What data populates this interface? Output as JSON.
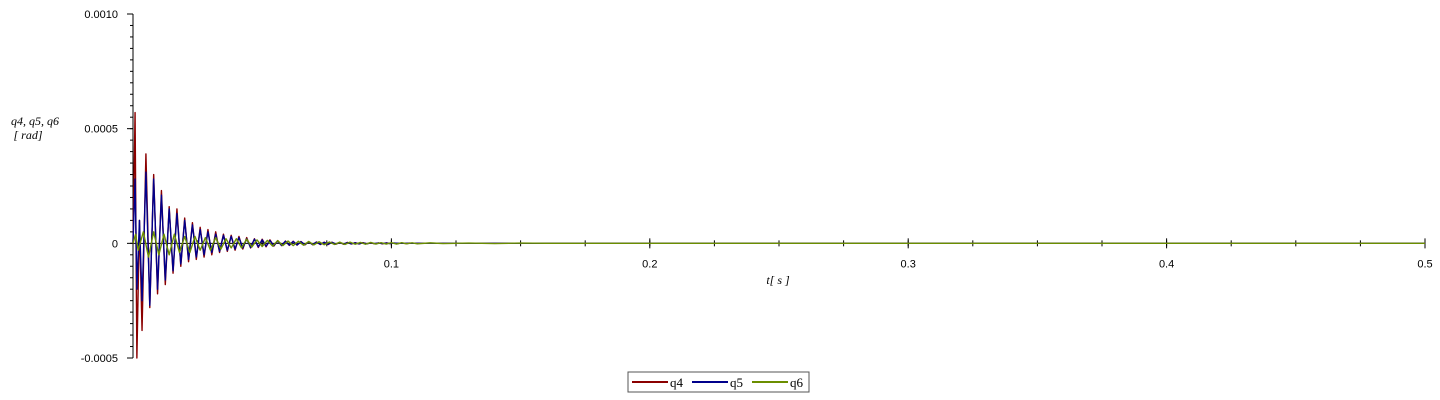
{
  "chart_data": {
    "type": "line",
    "title": "",
    "xlabel": "t[ s ]",
    "ylabel_lines": [
      "q4, q5, q6",
      "[ rad]"
    ],
    "xlim": [
      0,
      0.5
    ],
    "ylim": [
      -0.0005,
      0.001
    ],
    "x_ticks": [
      0.1,
      0.2,
      0.3,
      0.4,
      0.5
    ],
    "x_tick_labels": [
      "0.1",
      "0.2",
      "0.3",
      "0.4",
      "0.5"
    ],
    "y_ticks": [
      0.001,
      0.0005,
      0,
      -0.0005
    ],
    "y_tick_labels": [
      "0.0010",
      "0.0005",
      "0",
      "-0.0005"
    ],
    "grid": false,
    "legend_position": "bottom-center",
    "series": [
      {
        "name": "q4",
        "color": "#8b0000",
        "x": [
          0,
          0.0008,
          0.0015,
          0.0025,
          0.0035,
          0.005,
          0.0065,
          0.008,
          0.0095,
          0.011,
          0.0125,
          0.014,
          0.0155,
          0.017,
          0.0185,
          0.02,
          0.0215,
          0.023,
          0.0245,
          0.026,
          0.0275,
          0.029,
          0.0305,
          0.032,
          0.0335,
          0.035,
          0.0365,
          0.038,
          0.0395,
          0.041,
          0.0425,
          0.044,
          0.0455,
          0.047,
          0.0485,
          0.05,
          0.0515,
          0.053,
          0.0545,
          0.056,
          0.0575,
          0.059,
          0.0605,
          0.062,
          0.0635,
          0.065,
          0.0665,
          0.068,
          0.0695,
          0.071,
          0.0725,
          0.074,
          0.0755,
          0.077,
          0.0785,
          0.08,
          0.0815,
          0.083,
          0.0845,
          0.086,
          0.0875,
          0.089,
          0.0905,
          0.092,
          0.0935,
          0.095,
          0.0965,
          0.098,
          0.0995,
          0.101,
          0.1025,
          0.104,
          0.1055,
          0.107,
          0.1085,
          0.11,
          0.12,
          0.14,
          0.16,
          0.18,
          0.2,
          0.3,
          0.4,
          0.5
        ],
        "y": [
          0,
          0.00057,
          -0.0005,
          0.0001,
          -0.00038,
          0.00039,
          -0.00028,
          0.0003,
          -0.00022,
          0.00023,
          -0.00018,
          0.00016,
          -0.00013,
          0.00015,
          -0.0001,
          0.00011,
          -8e-05,
          9e-05,
          -7e-05,
          7e-05,
          -6e-05,
          6e-05,
          -5e-05,
          5e-05,
          -4e-05,
          4e-05,
          -3.5e-05,
          3.5e-05,
          -3e-05,
          3e-05,
          -2.5e-05,
          2.5e-05,
          -2e-05,
          2e-05,
          -1.8e-05,
          1.8e-05,
          -1.5e-05,
          1.5e-05,
          -1.2e-05,
          1.2e-05,
          -1e-05,
          1e-05,
          -9e-06,
          9e-06,
          -8e-06,
          8e-06,
          -7e-06,
          7e-06,
          -6e-06,
          6e-06,
          -5e-06,
          5e-06,
          -5e-06,
          5e-06,
          -4e-06,
          4e-06,
          -4e-06,
          4e-06,
          -3e-06,
          3e-06,
          -3e-06,
          3e-06,
          -2e-06,
          2e-06,
          -2e-06,
          2e-06,
          -2e-06,
          2e-06,
          -1e-06,
          1e-06,
          -1e-06,
          1e-06,
          -1e-06,
          1e-06,
          0,
          0,
          0,
          0,
          0,
          0,
          0,
          0,
          0,
          0
        ]
      },
      {
        "name": "q5",
        "color": "#00008b",
        "x": [
          0,
          0.0008,
          0.0015,
          0.0025,
          0.0035,
          0.005,
          0.0065,
          0.008,
          0.0095,
          0.011,
          0.0125,
          0.014,
          0.0155,
          0.017,
          0.0185,
          0.02,
          0.0215,
          0.023,
          0.0245,
          0.026,
          0.0275,
          0.029,
          0.0305,
          0.032,
          0.0335,
          0.035,
          0.0365,
          0.038,
          0.0395,
          0.041,
          0.0425,
          0.044,
          0.0455,
          0.047,
          0.0485,
          0.05,
          0.0515,
          0.053,
          0.0545,
          0.056,
          0.0575,
          0.059,
          0.0605,
          0.062,
          0.0635,
          0.065,
          0.0665,
          0.068,
          0.0695,
          0.071,
          0.0725,
          0.074,
          0.0755,
          0.077,
          0.0785,
          0.08,
          0.0815,
          0.083,
          0.0845,
          0.086,
          0.0875,
          0.089,
          0.0905,
          0.092,
          0.0935,
          0.095,
          0.0965,
          0.098,
          0.0995,
          0.101,
          0.1025,
          0.104,
          0.1055,
          0.107,
          0.1085,
          0.11,
          0.12,
          0.14,
          0.16,
          0.18,
          0.19,
          0.2,
          0.3,
          0.4,
          0.5
        ],
        "y": [
          0,
          0.00028,
          -0.0002,
          0.0001,
          -0.00025,
          0.00031,
          -0.00027,
          0.00028,
          -0.0002,
          0.00021,
          -0.00016,
          0.00015,
          -0.00012,
          0.00013,
          -9e-05,
          0.0001,
          -7e-05,
          8e-05,
          -6e-05,
          6e-05,
          -5e-05,
          5e-05,
          -4e-05,
          4e-05,
          -3.5e-05,
          3.5e-05,
          -3e-05,
          3e-05,
          -2.5e-05,
          2.5e-05,
          -2e-05,
          2e-05,
          -1.8e-05,
          1.8e-05,
          -1.5e-05,
          1.5e-05,
          -1.2e-05,
          1.2e-05,
          -1e-05,
          1e-05,
          -9e-06,
          9e-06,
          -8e-06,
          8e-06,
          -7e-06,
          7e-06,
          -6e-06,
          6e-06,
          -5e-06,
          5e-06,
          -4e-06,
          4e-06,
          -4e-06,
          4e-06,
          -3e-06,
          3e-06,
          -3e-06,
          3e-06,
          -2e-06,
          2e-06,
          -2e-06,
          2e-06,
          -2e-06,
          2e-06,
          -1e-06,
          1e-06,
          -1e-06,
          1e-06,
          -1e-06,
          1e-06,
          0,
          0,
          0,
          0,
          0,
          0,
          0,
          0,
          0,
          0,
          0,
          0,
          0,
          0,
          0
        ]
      },
      {
        "name": "q6",
        "color": "#6b8e00",
        "x": [
          0,
          0.001,
          0.002,
          0.004,
          0.006,
          0.008,
          0.01,
          0.012,
          0.014,
          0.016,
          0.018,
          0.02,
          0.022,
          0.024,
          0.026,
          0.028,
          0.03,
          0.032,
          0.034,
          0.036,
          0.038,
          0.04,
          0.042,
          0.044,
          0.046,
          0.048,
          0.05,
          0.052,
          0.054,
          0.056,
          0.058,
          0.06,
          0.062,
          0.064,
          0.066,
          0.068,
          0.07,
          0.072,
          0.074,
          0.076,
          0.078,
          0.08,
          0.082,
          0.084,
          0.086,
          0.088,
          0.09,
          0.092,
          0.094,
          0.096,
          0.098,
          0.1,
          0.102,
          0.104,
          0.106,
          0.108,
          0.11,
          0.115,
          0.12,
          0.13,
          0.14,
          0.15,
          0.16,
          0.18,
          0.2,
          0.3,
          0.4,
          0.5
        ],
        "y": [
          0,
          4e-05,
          -3e-05,
          5e-05,
          -6e-05,
          5e-05,
          -5e-05,
          4e-05,
          -5e-05,
          4e-05,
          -4e-05,
          3e-05,
          -4e-05,
          3e-05,
          -3e-05,
          2.5e-05,
          -3e-05,
          2.5e-05,
          -2.5e-05,
          2e-05,
          -2e-05,
          2e-05,
          -2e-05,
          1.8e-05,
          -1.6e-05,
          1.5e-05,
          -1.4e-05,
          1.3e-05,
          -1.2e-05,
          1.2e-05,
          -1e-05,
          1e-05,
          -1e-05,
          9e-06,
          -8e-06,
          8e-06,
          -7e-06,
          7e-06,
          -6e-06,
          6e-06,
          -5e-06,
          5e-06,
          -5e-06,
          5e-06,
          -4e-06,
          4e-06,
          -4e-06,
          4e-06,
          -3e-06,
          3e-06,
          -3e-06,
          3e-06,
          -3e-06,
          3e-06,
          -2e-06,
          2e-06,
          -2e-06,
          2e-06,
          -1e-06,
          1e-06,
          -1e-06,
          1e-06,
          0,
          0,
          0,
          0,
          0,
          0
        ]
      }
    ]
  }
}
